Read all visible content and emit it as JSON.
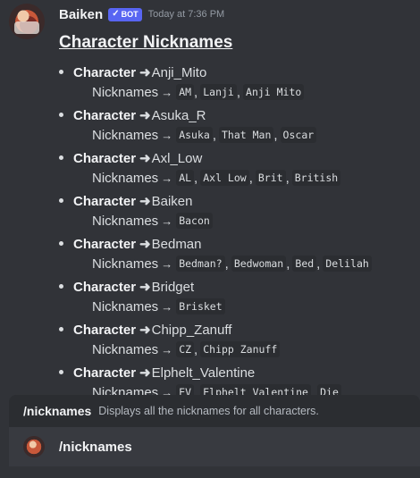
{
  "message": {
    "username": "Baiken",
    "bot_tag": "BOT",
    "timestamp": "Today at 7:36 PM",
    "title": "Character Nicknames",
    "character_label": "Character",
    "nicknames_label": "Nicknames",
    "characters": [
      {
        "name": "Anji_Mito",
        "nicknames": [
          "AM",
          "Lanji",
          "Anji Mito"
        ]
      },
      {
        "name": "Asuka_R",
        "nicknames": [
          "Asuka",
          "That Man",
          "Oscar"
        ]
      },
      {
        "name": "Axl_Low",
        "nicknames": [
          "AL",
          "Axl Low",
          "Brit",
          "British"
        ]
      },
      {
        "name": "Baiken",
        "nicknames": [
          "Bacon"
        ]
      },
      {
        "name": "Bedman",
        "nicknames": [
          "Bedman?",
          "Bedwoman",
          "Bed",
          "Delilah"
        ]
      },
      {
        "name": "Bridget",
        "nicknames": [
          "Brisket"
        ]
      },
      {
        "name": "Chipp_Zanuff",
        "nicknames": [
          "CZ",
          "Chipp Zanuff"
        ]
      },
      {
        "name": "Elphelt_Valentine",
        "nicknames": [
          "EV",
          "Elphelt Valentine",
          "Die"
        ]
      }
    ]
  },
  "command_bar": {
    "command": "/nicknames",
    "description": "Displays all the nicknames for all characters."
  },
  "input": {
    "value": "/nicknames"
  },
  "icons": {
    "bot_check": "checkmark-icon",
    "arrow": "arrow-right-icon"
  },
  "colors": {
    "background": "#313338",
    "bot_tag": "#5865f2",
    "code_background": "#2b2d31",
    "command_bar": "#2b2d31",
    "input_bar": "#383a40"
  }
}
